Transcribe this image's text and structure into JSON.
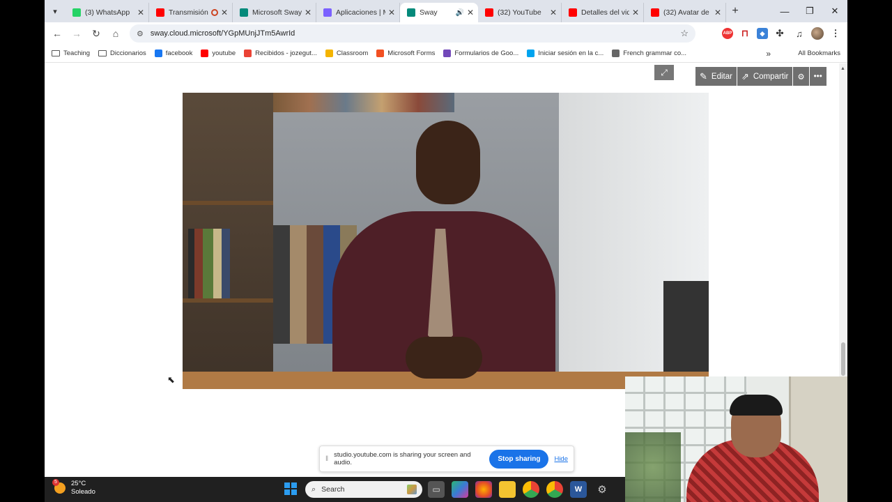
{
  "tabs": [
    {
      "title": "(3) WhatsApp",
      "color": "#25d366"
    },
    {
      "title": "Transmisión",
      "color": "#ff0000"
    },
    {
      "title": "Microsoft Sway",
      "color": "#058a7b"
    },
    {
      "title": "Aplicaciones | M",
      "color": "#7b61ff"
    },
    {
      "title": "Sway",
      "color": "#058a7b",
      "active": true
    },
    {
      "title": "(32) YouTube",
      "color": "#ff0000"
    },
    {
      "title": "Detalles del vid",
      "color": "#ff0000"
    },
    {
      "title": "(32) Avatar de",
      "color": "#ff0000"
    }
  ],
  "address": {
    "url": "sway.cloud.microsoft/YGpMUnjJTm5AwrId"
  },
  "bookmarks": [
    {
      "label": "Teaching",
      "type": "folder"
    },
    {
      "label": "Diccionarios",
      "type": "folder"
    },
    {
      "label": "facebook",
      "color": "#1877f2"
    },
    {
      "label": "youtube",
      "color": "#ff0000"
    },
    {
      "label": "Recibidos - jozegut...",
      "color": "#ea4335"
    },
    {
      "label": "Classroom",
      "color": "#f4b400"
    },
    {
      "label": "Microsoft Forms",
      "color": "#f25022"
    },
    {
      "label": "Formularios de Goo...",
      "color": "#7248b9"
    },
    {
      "label": "Iniciar sesión en la c...",
      "color": "#00a4ef"
    },
    {
      "label": "French grammar co...",
      "color": "#666666"
    }
  ],
  "bookmarks_all": "All Bookmarks",
  "sway": {
    "edit": "Editar",
    "share": "Compartir"
  },
  "share_bar": {
    "message": "studio.youtube.com is sharing your screen and audio.",
    "stop": "Stop sharing",
    "hide": "Hide"
  },
  "taskbar": {
    "temp": "25°C",
    "condition": "Soleado",
    "badge": "5",
    "search": "Search"
  }
}
